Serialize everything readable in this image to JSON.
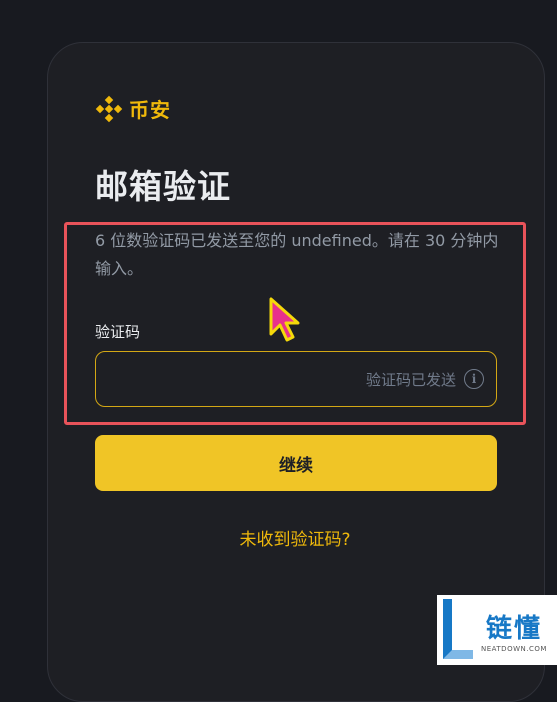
{
  "brand": {
    "name": "币安",
    "color": "#f0b90b",
    "logo_icon": "binance-diamond-logo"
  },
  "page": {
    "title": "邮箱验证"
  },
  "info": {
    "text": "6 位数验证码已发送至您的 undefined。请在 30 分钟内输入。"
  },
  "code_field": {
    "label": "验证码",
    "value": "",
    "hint": "验证码已发送",
    "info_icon": "info-circle-icon"
  },
  "actions": {
    "continue_label": "继续",
    "resend_label": "未收到验证码?"
  },
  "colors": {
    "background": "#181a20",
    "card": "#1e1f24",
    "accent": "#f0c526",
    "highlight": "#e8535a"
  },
  "watermark": {
    "cn": "链懂",
    "en": "NEATDOWN.COM"
  }
}
